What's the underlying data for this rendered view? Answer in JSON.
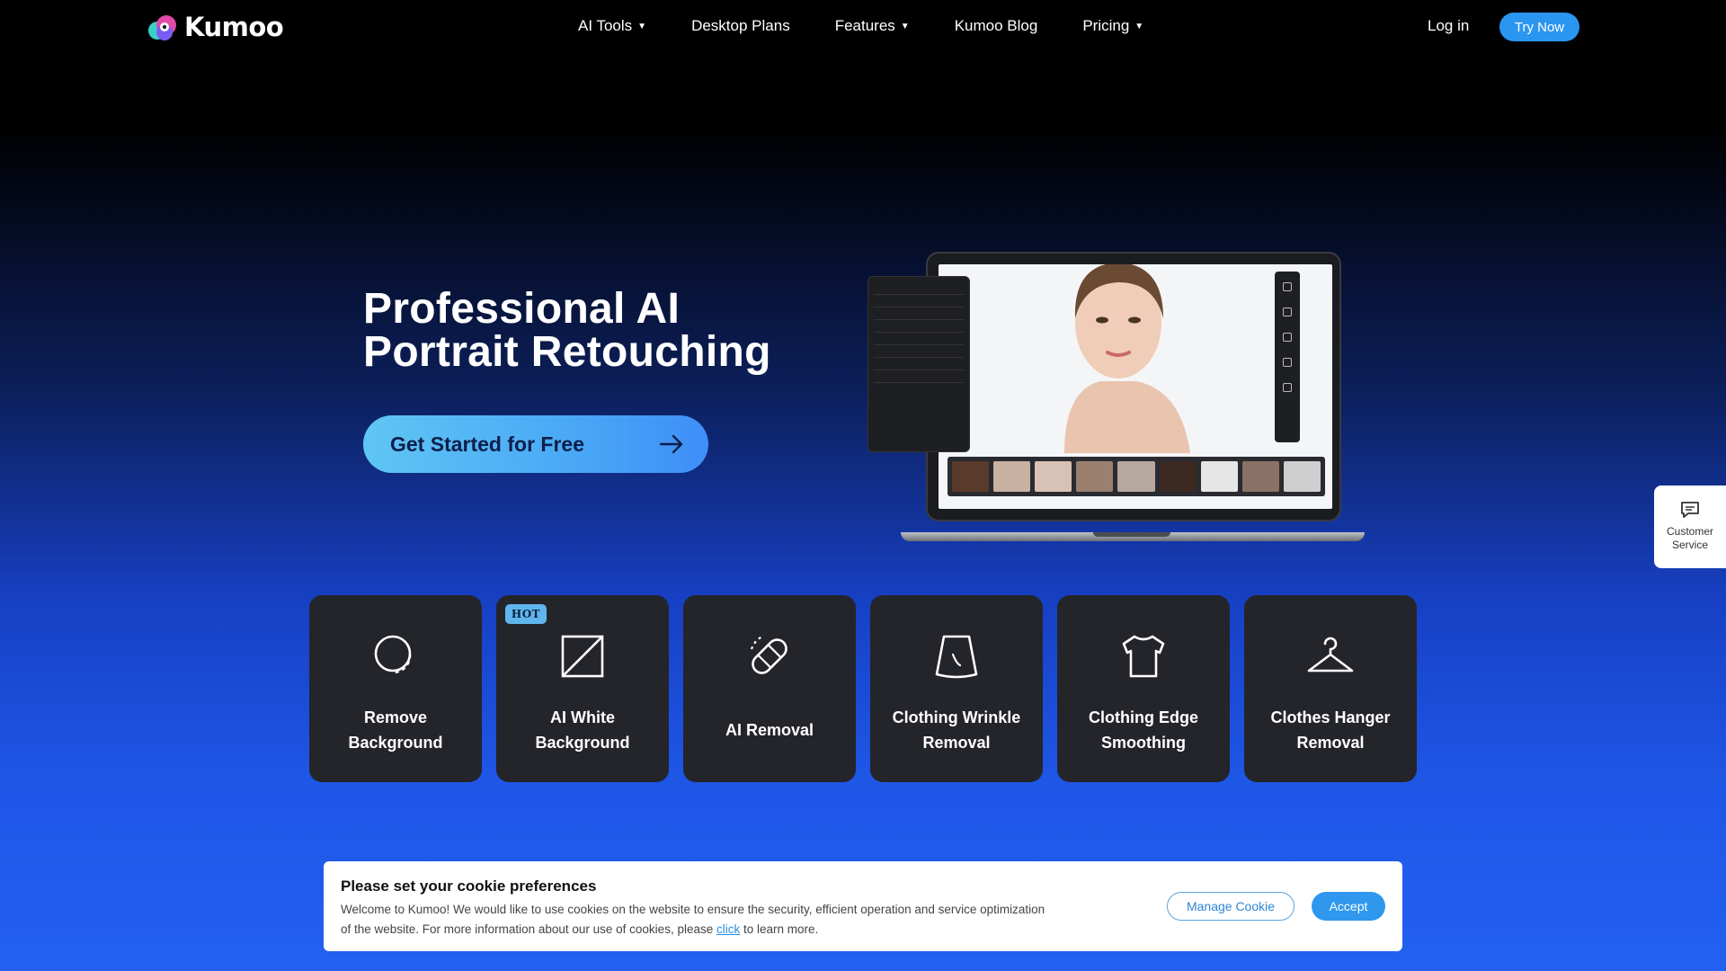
{
  "brand": {
    "name": "Kumoo"
  },
  "nav": {
    "items": [
      {
        "label": "AI Tools",
        "has_dropdown": true
      },
      {
        "label": "Desktop Plans",
        "has_dropdown": false
      },
      {
        "label": "Features",
        "has_dropdown": true
      },
      {
        "label": "Kumoo Blog",
        "has_dropdown": false
      },
      {
        "label": "Pricing",
        "has_dropdown": true
      }
    ],
    "login_label": "Log in",
    "try_label": "Try Now"
  },
  "hero": {
    "title_line1": "Professional AI",
    "title_line2": "Portrait Retouching",
    "cta_label": "Get Started for Free"
  },
  "tools": [
    {
      "label_line1": "Remove",
      "label_line2": "Background",
      "icon": "remove-background-icon"
    },
    {
      "label_line1": "AI White",
      "label_line2": "Background",
      "icon": "white-background-icon",
      "badge": "HOT"
    },
    {
      "label_line1": "AI Removal",
      "label_line2": "",
      "icon": "bandage-icon"
    },
    {
      "label_line1": "Clothing Wrinkle",
      "label_line2": "Removal",
      "icon": "skirt-icon"
    },
    {
      "label_line1": "Clothing Edge",
      "label_line2": "Smoothing",
      "icon": "shirt-icon"
    },
    {
      "label_line1": "Clothes Hanger",
      "label_line2": "Removal",
      "icon": "hanger-icon"
    }
  ],
  "customer_service": {
    "line1": "Customer",
    "line2": "Service"
  },
  "cookie": {
    "title": "Please set your cookie preferences",
    "text_line1": "Welcome to Kumoo! We would like to use cookies on the website to ensure the security, efficient operation and service optimization",
    "text_line2_before": "of the website. For more information about our use of cookies, please ",
    "link_label": "click",
    "text_line2_after": " to learn more.",
    "manage_label": "Manage Cookie",
    "accept_label": "Accept"
  },
  "colors": {
    "accent": "#2b96f0",
    "card_bg": "#24252a",
    "hot_badge": "#5fb6ee"
  }
}
